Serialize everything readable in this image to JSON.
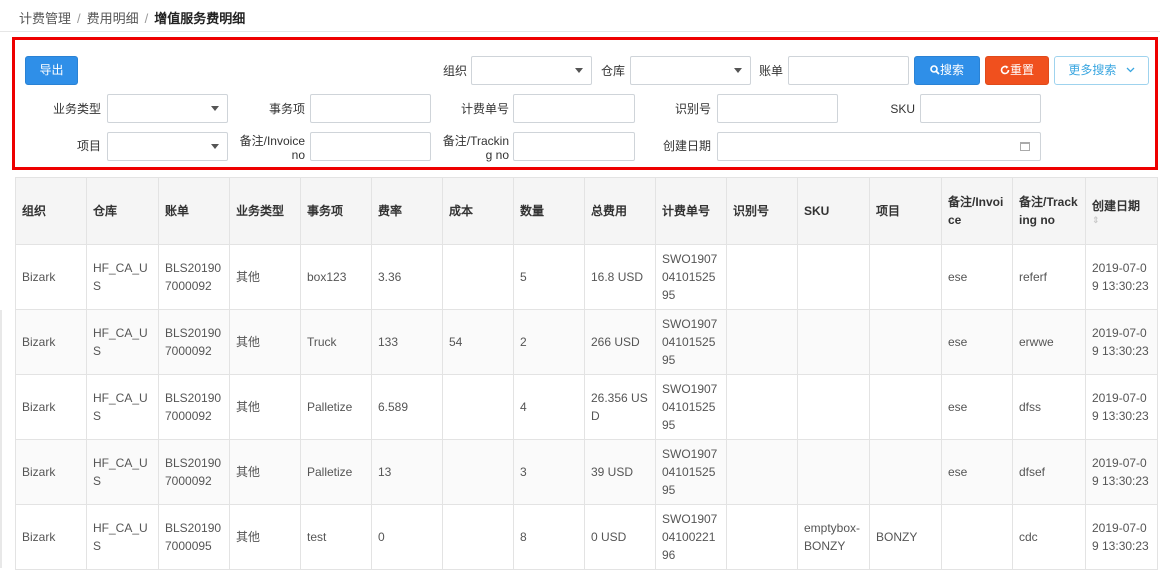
{
  "breadcrumb": {
    "items": [
      "计费管理",
      "费用明细"
    ],
    "separator": "/",
    "current": "增值服务费明细"
  },
  "toolbar": {
    "export_label": "导出",
    "search_label": "搜索",
    "reset_label": "重置",
    "more_search_label": "更多搜索"
  },
  "filters": {
    "org_label": "组织",
    "warehouse_label": "仓库",
    "bill_label": "账单",
    "business_type_label": "业务类型",
    "item_label": "事务项",
    "billing_no_label": "计费单号",
    "identifier_label": "识别号",
    "sku_label": "SKU",
    "project_label": "项目",
    "invoice_note_label_1": "备注/Invoice",
    "invoice_note_label_2": "no",
    "tracking_note_label_1": "备注/Trackin",
    "tracking_note_label_2": "g no",
    "created_date_label": "创建日期"
  },
  "table": {
    "headers": {
      "org": "组织",
      "warehouse": "仓库",
      "bill": "账单",
      "business_type": "业务类型",
      "item": "事务项",
      "rate": "费率",
      "cost": "成本",
      "quantity": "数量",
      "total_fee": "总费用",
      "billing_no": "计费单号",
      "identifier": "识别号",
      "sku": "SKU",
      "project": "项目",
      "invoice_note": "备注/Invoice",
      "tracking_note": "备注/Tracking no",
      "created_date": "创建日期"
    },
    "rows": [
      {
        "org": "Bizark",
        "warehouse": "HF_CA_US",
        "bill": "BLS201907000092",
        "business_type": "其他",
        "item": "box123",
        "rate": "3.36",
        "cost": "",
        "quantity": "5",
        "total_fee": "16.8 USD",
        "billing_no": "SWO190704101525 95",
        "identifier": "",
        "sku": "",
        "project": "",
        "invoice_note": "ese",
        "tracking_note": "referf",
        "created_date": "2019-07-09 13:30:23"
      },
      {
        "org": "Bizark",
        "warehouse": "HF_CA_US",
        "bill": "BLS201907000092",
        "business_type": "其他",
        "item": "Truck",
        "rate": "133",
        "cost": "54",
        "quantity": "2",
        "total_fee": "266 USD",
        "billing_no": "SWO190704101525 95",
        "identifier": "",
        "sku": "",
        "project": "",
        "invoice_note": "ese",
        "tracking_note": "erwwe",
        "created_date": "2019-07-09 13:30:23"
      },
      {
        "org": "Bizark",
        "warehouse": "HF_CA_US",
        "bill": "BLS201907000092",
        "business_type": "其他",
        "item": "Palletize",
        "rate": "6.589",
        "cost": "",
        "quantity": "4",
        "total_fee": "26.356 USD",
        "billing_no": "SWO190704101525 95",
        "identifier": "",
        "sku": "",
        "project": "",
        "invoice_note": "ese",
        "tracking_note": "dfss",
        "created_date": "2019-07-09 13:30:23"
      },
      {
        "org": "Bizark",
        "warehouse": "HF_CA_US",
        "bill": "BLS201907000092",
        "business_type": "其他",
        "item": "Palletize",
        "rate": "13",
        "cost": "",
        "quantity": "3",
        "total_fee": "39 USD",
        "billing_no": "SWO190704101525 95",
        "identifier": "",
        "sku": "",
        "project": "",
        "invoice_note": "ese",
        "tracking_note": "dfsef",
        "created_date": "2019-07-09 13:30:23"
      },
      {
        "org": "Bizark",
        "warehouse": "HF_CA_US",
        "bill": "BLS201907000095",
        "business_type": "其他",
        "item": "test",
        "rate": "0",
        "cost": "",
        "quantity": "8",
        "total_fee": "0 USD",
        "billing_no": "SWO190704100221 96",
        "identifier": "",
        "sku": "emptybox-BONZY",
        "project": "BONZY",
        "invoice_note": "",
        "tracking_note": "cdc",
        "created_date": "2019-07-09 13:30:23"
      }
    ]
  },
  "icons": {
    "search": "search-icon",
    "reset": "refresh-icon",
    "more": "chevron-down-icon",
    "calendar": "calendar-icon",
    "sort": "sort-icon"
  },
  "colors": {
    "primary": "#2f8fe8",
    "danger": "#f0501e",
    "highlight_border": "#ee0000"
  }
}
